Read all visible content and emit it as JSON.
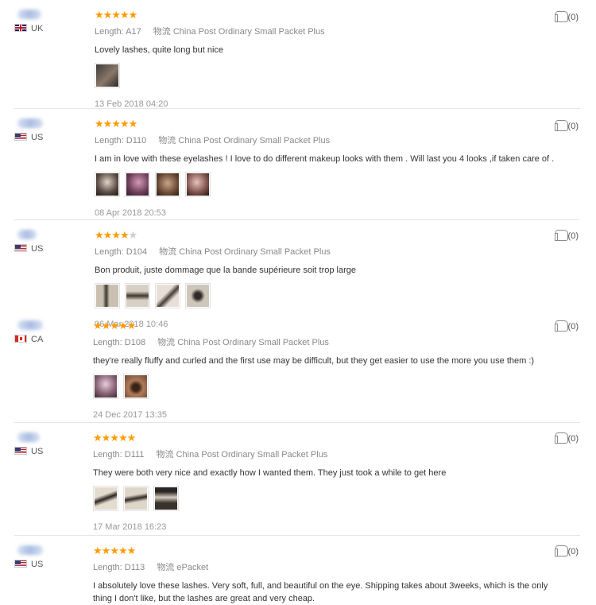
{
  "colors": {
    "star": "#ff9a00",
    "star_off": "#cfcfcf",
    "divider": "#e6e6e6"
  },
  "labels": {
    "length_prefix": "Length:",
    "shipping_prefix": "物流"
  },
  "reviews": [
    {
      "country": "UK",
      "flag": "uk",
      "rating": 5,
      "length": "A17",
      "shipping": "China Post Ordinary Small Packet Plus",
      "text": "Lovely lashes, quite long but nice",
      "photos": [
        "photo-1"
      ],
      "date": "13 Feb 2018 04:20",
      "helpful": "(0)"
    },
    {
      "country": "US",
      "flag": "us",
      "rating": 5,
      "length": "D110",
      "shipping": "China Post Ordinary Small Packet Plus",
      "text": "I am in love with these eyelashes ! I love to do different makeup looks with them . Will last you 4 looks ,if taken care of .",
      "photos": [
        "photo-1",
        "photo-2",
        "photo-3",
        "photo-4"
      ],
      "date": "08 Apr 2018 20:53",
      "helpful": "(0)"
    },
    {
      "country": "US",
      "flag": "us",
      "rating": 4,
      "length": "D104",
      "shipping": "China Post Ordinary Small Packet Plus",
      "text": "Bon produit, juste dommage que la bande supérieure soit trop large",
      "photos": [
        "photo-1",
        "photo-2",
        "photo-3",
        "photo-4"
      ],
      "date": "06 Mar 2018 10:46",
      "helpful": "(0)"
    },
    {
      "country": "CA",
      "flag": "ca",
      "rating": 5,
      "length": "D108",
      "shipping": "China Post Ordinary Small Packet Plus",
      "text": "they're really fluffy and curled and the first use may be difficult, but they get easier to use the more you use them :)",
      "photos": [
        "photo-1",
        "photo-2"
      ],
      "date": "24 Dec 2017 13:35",
      "helpful": "(0)"
    },
    {
      "country": "US",
      "flag": "us",
      "rating": 5,
      "length": "D111",
      "shipping": "China Post Ordinary Small Packet Plus",
      "text": "They were both very nice and exactly how I wanted them. They just took a while to get here",
      "photos": [
        "photo-1",
        "photo-2",
        "photo-3"
      ],
      "date": "17 Mar 2018 16:23",
      "helpful": "(0)"
    },
    {
      "country": "US",
      "flag": "us",
      "rating": 5,
      "length": "D113",
      "shipping": "ePacket",
      "text": "I absolutely love these lashes. Very soft, full, and beautiful on the eye. Shipping takes about 3weeks, which is the only thing I don't like, but the lashes are great and very cheap.",
      "photos": [],
      "date": "",
      "helpful": "(0)"
    }
  ]
}
